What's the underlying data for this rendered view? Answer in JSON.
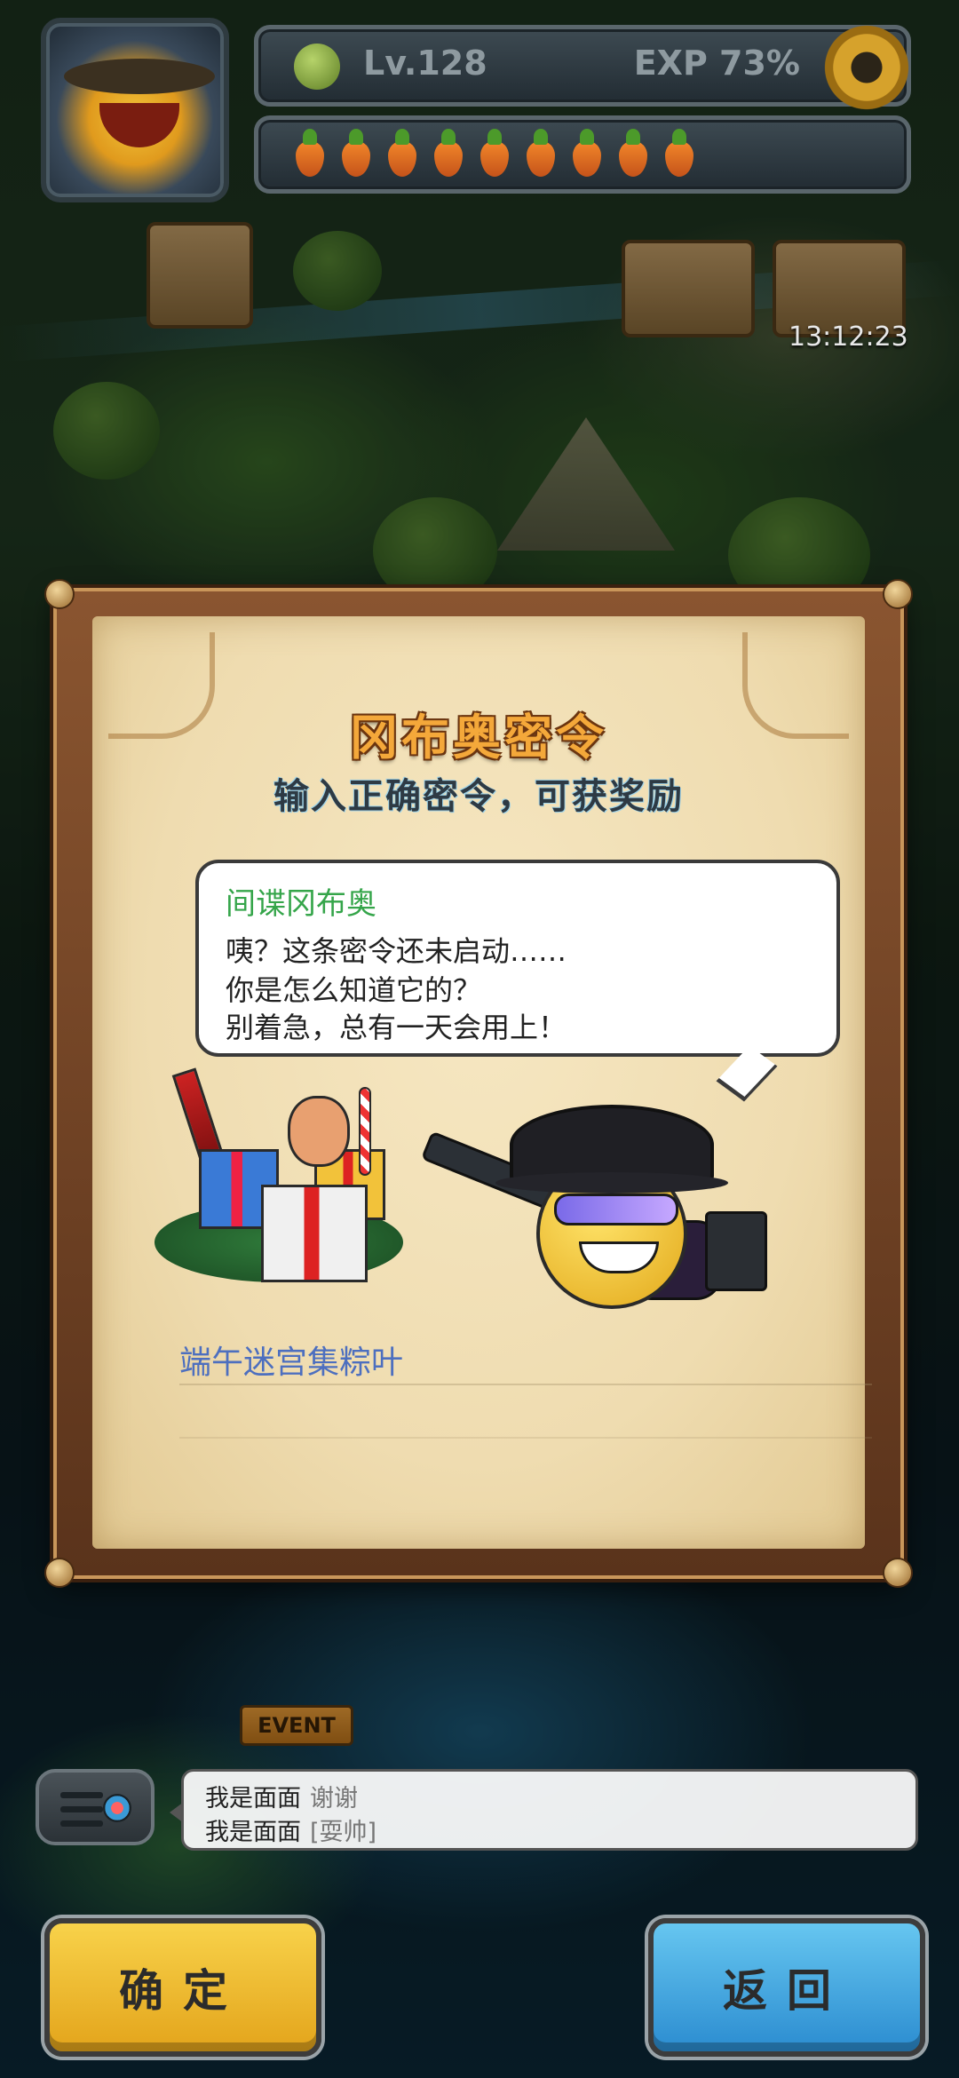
{
  "hud": {
    "level": "Lv.128",
    "exp": "EXP 73%",
    "stamina_count": 9,
    "timer": "13:12:23"
  },
  "dialog": {
    "title": "冈布奥密令",
    "subtitle": "输入正确密令，可获奖励",
    "speaker": "间谍冈布奥",
    "lines": [
      "咦？这条密令还未启动……",
      "你是怎么知道它的？",
      "别着急，总有一天会用上！"
    ],
    "code_value": "端午迷宫集粽叶"
  },
  "map_labels": {
    "event": "EVENT"
  },
  "chat": {
    "rows": [
      {
        "name": "我是面面",
        "msg": "谢谢"
      },
      {
        "name": "我是面面",
        "msg": "[耍帅]"
      }
    ]
  },
  "buttons": {
    "confirm": "确定",
    "back": "返回"
  },
  "colors": {
    "title_orange": "#f4a83a",
    "speaker_green": "#35a54a",
    "code_blue": "#4d6fbf",
    "confirm_yellow": "#f8d24a",
    "back_blue": "#2b8cd0"
  }
}
